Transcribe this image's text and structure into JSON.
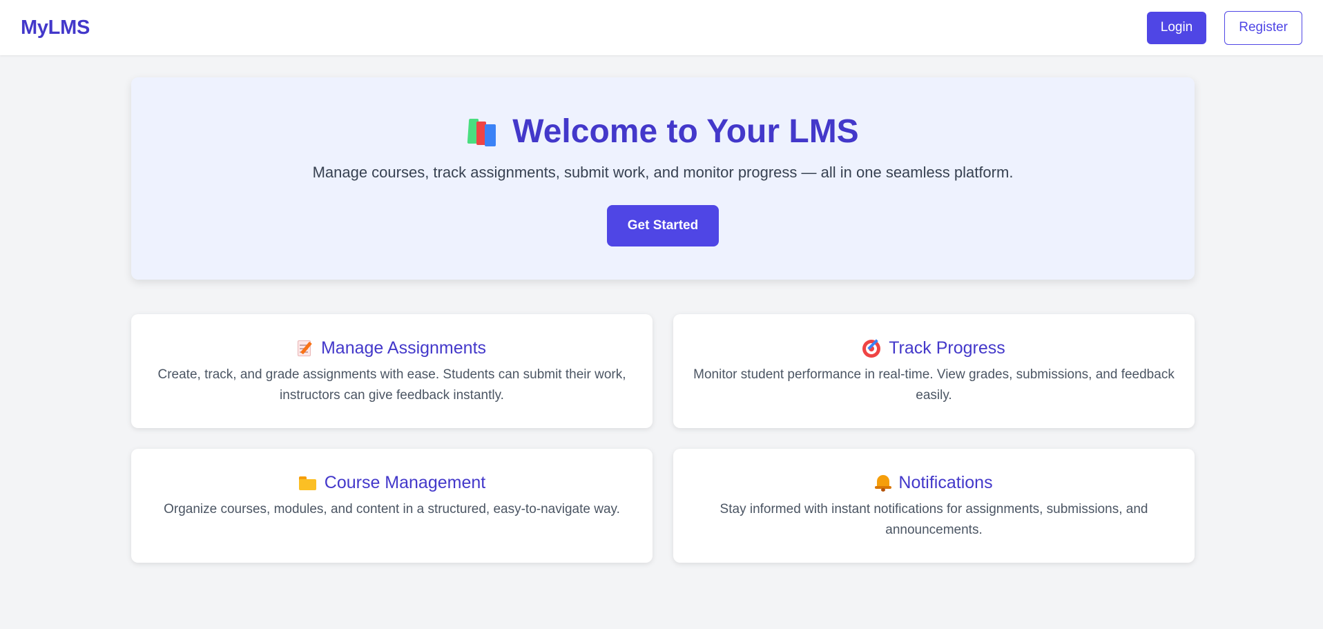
{
  "header": {
    "brand": "MyLMS",
    "login_label": "Login",
    "register_label": "Register"
  },
  "hero": {
    "icon": "books-icon",
    "title": "Welcome to Your LMS",
    "subtitle": "Manage courses, track assignments, submit work, and monitor progress — all in one seamless platform.",
    "cta_label": "Get Started"
  },
  "features": [
    {
      "icon": "memo-icon",
      "title": "Manage Assignments",
      "description": "Create, track, and grade assignments with ease. Students can submit their work, instructors can give feedback instantly."
    },
    {
      "icon": "target-icon",
      "title": "Track Progress",
      "description": "Monitor student performance in real-time. View grades, submissions, and feedback easily."
    },
    {
      "icon": "folder-icon",
      "title": "Course Management",
      "description": "Organize courses, modules, and content in a structured, easy-to-navigate way."
    },
    {
      "icon": "bell-icon",
      "title": "Notifications",
      "description": "Stay informed with instant notifications for assignments, submissions, and announcements."
    }
  ],
  "colors": {
    "accent": "#4f46e5",
    "heading": "#4338ca",
    "background": "#f3f4f6",
    "hero_background": "#eef2fe"
  }
}
